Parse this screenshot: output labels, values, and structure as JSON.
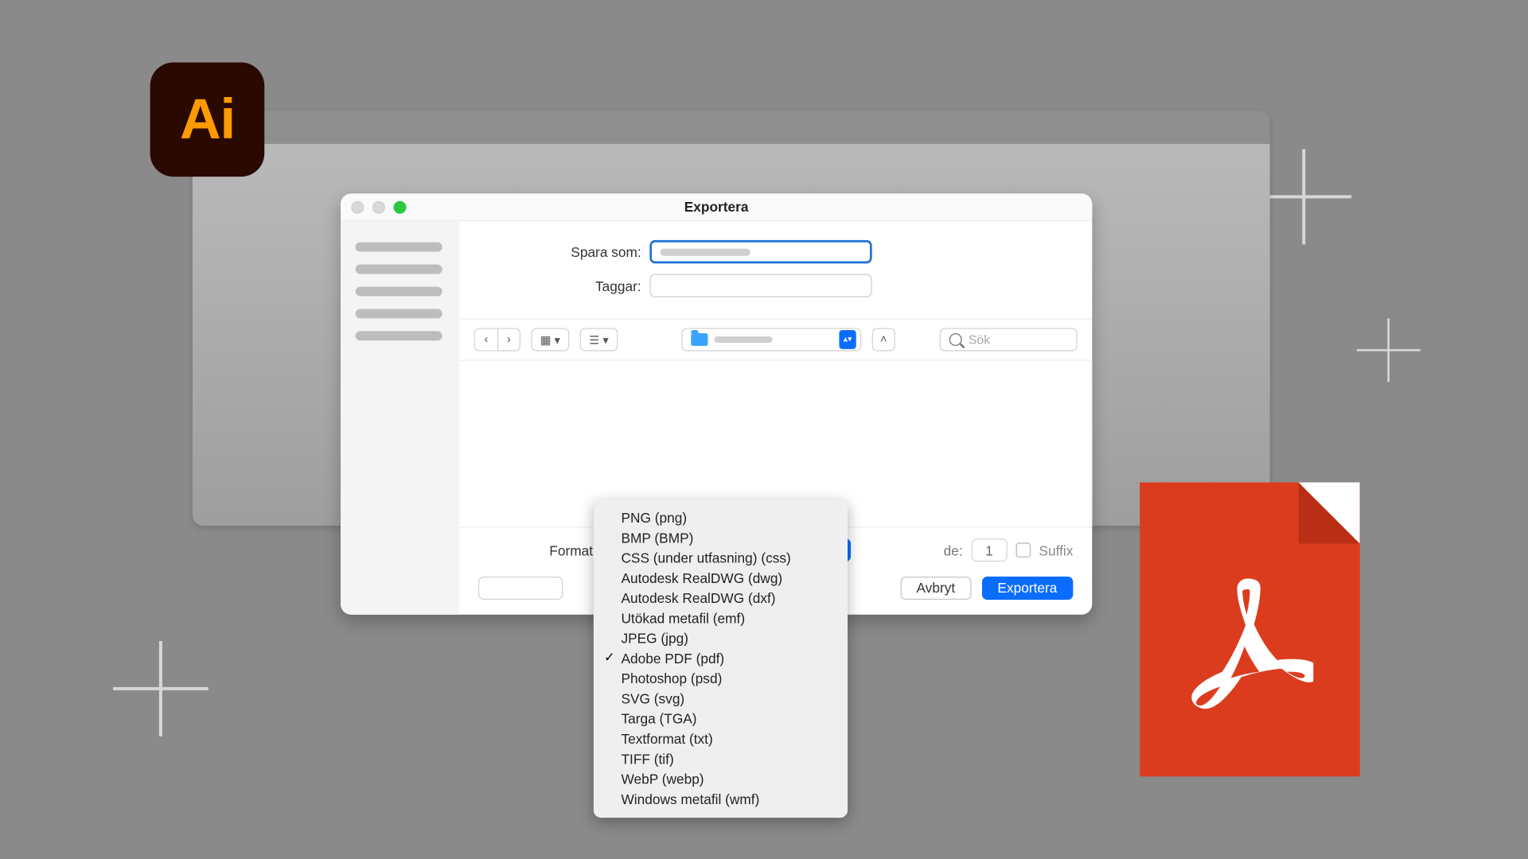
{
  "illustrator_icon_text": "Ai",
  "dialog": {
    "title": "Exportera",
    "save_as_label": "Spara som:",
    "tags_label": "Taggar:",
    "search_placeholder": "Sök",
    "format_label": "Format:",
    "scale_trailing_label": "de:",
    "scale_value": "1",
    "suffix_label": "Suffix",
    "cancel_button": "Avbryt",
    "export_button": "Exportera"
  },
  "format_menu": {
    "items": [
      {
        "label": "PNG (png)",
        "selected": false
      },
      {
        "label": "BMP (BMP)",
        "selected": false
      },
      {
        "label": "CSS (under utfasning) (css)",
        "selected": false
      },
      {
        "label": "Autodesk RealDWG (dwg)",
        "selected": false
      },
      {
        "label": "Autodesk RealDWG (dxf)",
        "selected": false
      },
      {
        "label": "Utökad metafil (emf)",
        "selected": false
      },
      {
        "label": "JPEG (jpg)",
        "selected": false
      },
      {
        "label": "Adobe PDF (pdf)",
        "selected": true
      },
      {
        "label": "Photoshop (psd)",
        "selected": false
      },
      {
        "label": "SVG (svg)",
        "selected": false
      },
      {
        "label": "Targa (TGA)",
        "selected": false
      },
      {
        "label": "Textformat (txt)",
        "selected": false
      },
      {
        "label": "TIFF (tif)",
        "selected": false
      },
      {
        "label": "WebP (webp)",
        "selected": false
      },
      {
        "label": "Windows metafil (wmf)",
        "selected": false
      }
    ]
  }
}
